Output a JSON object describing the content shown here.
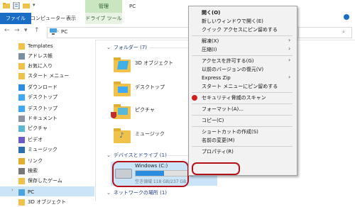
{
  "window": {
    "title": "PC",
    "contextual_tab": "管理"
  },
  "ribbon": {
    "tabs": [
      "ファイル",
      "コンピューター",
      "表示",
      "ドライブ ツール"
    ]
  },
  "address": {
    "path": "PC",
    "search_placeholder": ""
  },
  "sidebar": {
    "items": [
      {
        "label": "Templates",
        "icon": "folder-icon",
        "pinned": false
      },
      {
        "label": "アドレス帳",
        "icon": "contacts-icon",
        "pinned": false
      },
      {
        "label": "お気に入り",
        "icon": "star-icon",
        "pinned": false
      },
      {
        "label": "スタート メニュー",
        "icon": "folder-icon",
        "pinned": false
      },
      {
        "label": "ダウンロード",
        "icon": "download-icon",
        "pinned": false
      },
      {
        "label": "デスクトップ",
        "icon": "desktop-icon",
        "pinned": false
      },
      {
        "label": "デスクトップ",
        "icon": "desktop-icon",
        "pinned": false
      },
      {
        "label": "ドキュメント",
        "icon": "document-icon",
        "pinned": false
      },
      {
        "label": "ピクチャ",
        "icon": "picture-icon",
        "pinned": false
      },
      {
        "label": "ビデオ",
        "icon": "video-icon",
        "pinned": false
      },
      {
        "label": "ミュージック",
        "icon": "music-icon",
        "pinned": false
      },
      {
        "label": "リンク",
        "icon": "link-icon",
        "pinned": false
      },
      {
        "label": "検索",
        "icon": "search-icon",
        "pinned": false
      },
      {
        "label": "保存したゲーム",
        "icon": "folder-icon",
        "pinned": false
      },
      {
        "label": "PC",
        "icon": "pc-icon",
        "pinned": false,
        "selected": true
      },
      {
        "label": "3D オブジェクト",
        "icon": "folder-icon",
        "pinned": false
      }
    ]
  },
  "content": {
    "folders_header": "フォルダー (7)",
    "folders": [
      {
        "label": "3D オブジェクト"
      },
      {
        "label": "デスクトップ"
      },
      {
        "label": "ピクチャ"
      },
      {
        "label": "ミュージック"
      }
    ],
    "devices_header": "デバイスとドライブ (1)",
    "drive": {
      "name": "Windows (C:)",
      "space": "空き領域 118 GB/237 GB",
      "used_fraction": 0.5
    },
    "network_header": "ネットワークの場所 (1)"
  },
  "context_menu": {
    "items": [
      {
        "label": "開く(O)",
        "bold": true,
        "submenu": false
      },
      {
        "label": "新しいウィンドウで開く(E)",
        "submenu": false
      },
      {
        "label": "クイック アクセスにピン留めする",
        "submenu": false
      },
      {
        "sep": true
      },
      {
        "label": "解凍(X)",
        "submenu": true
      },
      {
        "label": "圧縮(I)",
        "submenu": true
      },
      {
        "sep": true
      },
      {
        "label": "アクセスを許可する(G)",
        "submenu": true
      },
      {
        "label": "以前のバージョンの復元(V)",
        "submenu": false
      },
      {
        "label": "Express Zip",
        "submenu": true
      },
      {
        "label": "スタート メニューにピン留めする",
        "submenu": false
      },
      {
        "sep": true
      },
      {
        "label": "セキュリティ脅威のスキャン",
        "submenu": false,
        "icon": "trend-micro-icon"
      },
      {
        "sep": true
      },
      {
        "label": "フォーマット(A)...",
        "submenu": false
      },
      {
        "sep": true
      },
      {
        "label": "コピー(C)",
        "submenu": false
      },
      {
        "sep": true
      },
      {
        "label": "ショートカットの作成(S)",
        "submenu": false
      },
      {
        "label": "名前の変更(M)",
        "submenu": false
      },
      {
        "sep": true
      },
      {
        "label": "プロパティ(R)",
        "submenu": false,
        "highlighted": true
      }
    ]
  },
  "colors": {
    "accent": "#1a6dc4",
    "selection": "#cce4f7",
    "highlight_ring": "#b5111a",
    "contextual_tab": "#c9e6c0"
  }
}
